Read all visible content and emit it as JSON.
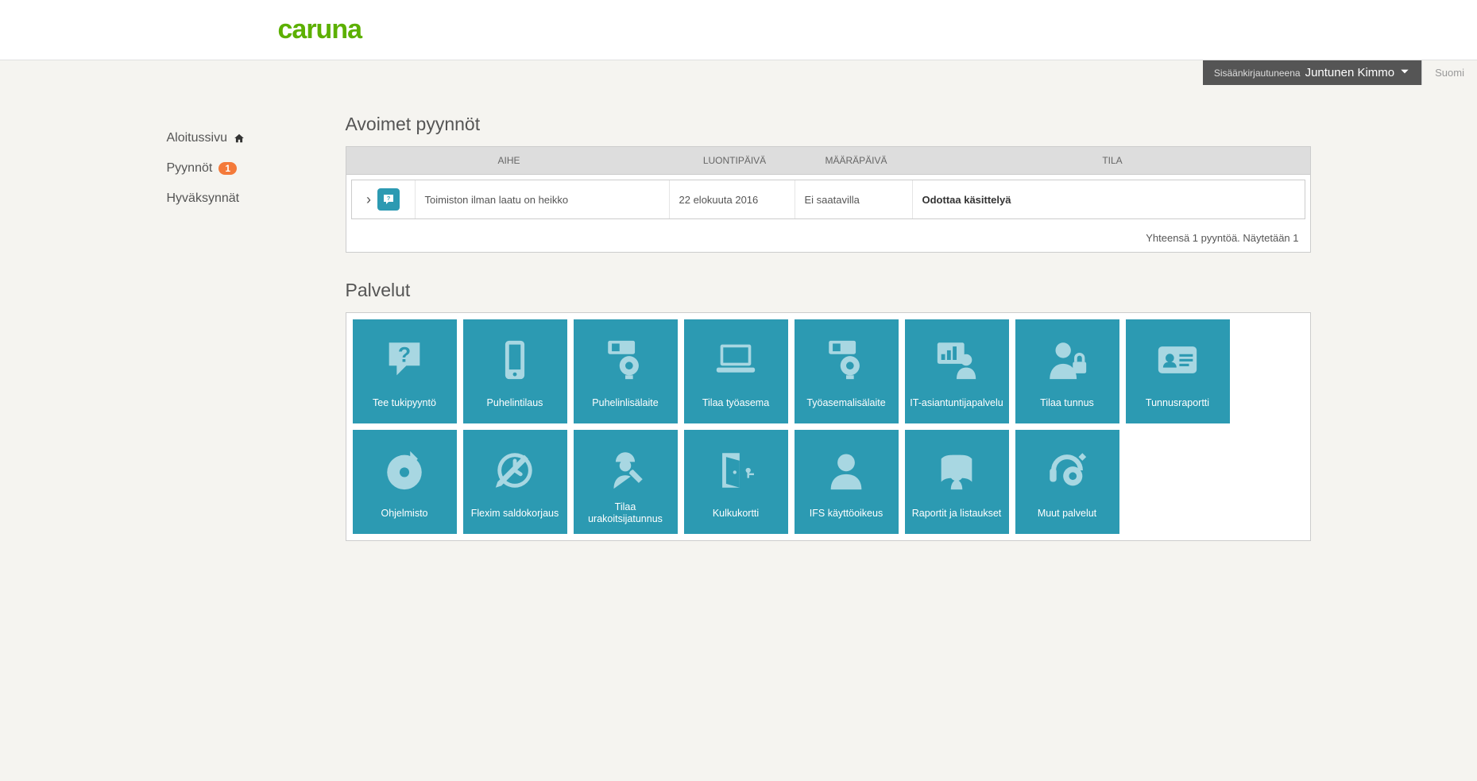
{
  "brand": "caruna",
  "user": {
    "prefix": "Sisäänkirjautuneena",
    "name": "Juntunen Kimmo"
  },
  "language": "Suomi",
  "sidebar": {
    "home": "Aloitussivu",
    "requests": "Pyynnöt",
    "requests_badge": "1",
    "approvals": "Hyväksynnät"
  },
  "requests": {
    "title": "Avoimet pyynnöt",
    "cols": {
      "subject": "AIHE",
      "created": "LUONTIPÄIVÄ",
      "due": "MÄÄRÄPÄIVÄ",
      "status": "TILA"
    },
    "rows": [
      {
        "subject": "Toimiston ilman laatu on heikko",
        "created": "22 elokuuta 2016",
        "due": "Ei saatavilla",
        "status": "Odottaa käsittelyä"
      }
    ],
    "footer": "Yhteensä 1 pyyntöä. Näytetään 1"
  },
  "services": {
    "title": "Palvelut",
    "tiles": [
      {
        "label": "Tee tukipyyntö",
        "icon": "question"
      },
      {
        "label": "Puhelintilaus",
        "icon": "phone"
      },
      {
        "label": "Puhelinlisälaite",
        "icon": "webcam"
      },
      {
        "label": "Tilaa työasema",
        "icon": "laptop"
      },
      {
        "label": "Työasemalisälaite",
        "icon": "webcam"
      },
      {
        "label": "IT-asiantuntijapalvelu",
        "icon": "consult"
      },
      {
        "label": "Tilaa tunnus",
        "icon": "userlock"
      },
      {
        "label": "Tunnusraportti",
        "icon": "idcard"
      },
      {
        "label": "Ohjelmisto",
        "icon": "disc"
      },
      {
        "label": "Flexim saldokorjaus",
        "icon": "clock"
      },
      {
        "label": "Tilaa urakoitsijatunnus",
        "icon": "contractor"
      },
      {
        "label": "Kulkukortti",
        "icon": "door"
      },
      {
        "label": "IFS käyttöoikeus",
        "icon": "user"
      },
      {
        "label": "Raportit ja listaukset",
        "icon": "report"
      },
      {
        "label": "Muut palvelut",
        "icon": "headset"
      }
    ]
  }
}
